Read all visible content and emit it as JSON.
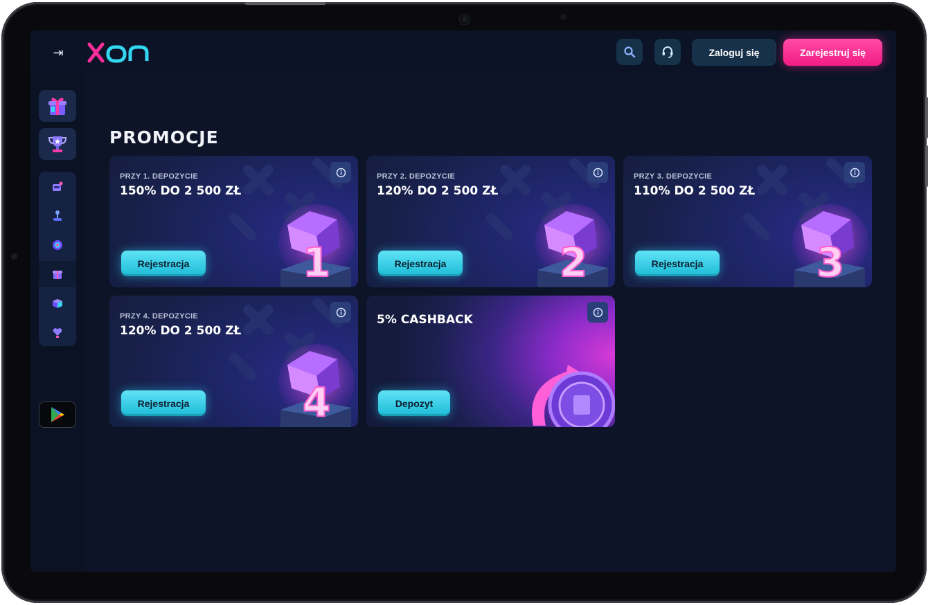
{
  "header": {
    "brand": "XON",
    "login_label": "Zaloguj się",
    "register_label": "Zarejestruj się"
  },
  "page": {
    "title": "PROMOCJE"
  },
  "promotions": [
    {
      "kicker": "PRZY 1. DEPOZYCIE",
      "headline": "150% DO 2 500 ZŁ",
      "cta": "Rejestracja",
      "digit": "1"
    },
    {
      "kicker": "PRZY 2. DEPOZYCIE",
      "headline": "120% DO 2 500 ZŁ",
      "cta": "Rejestracja",
      "digit": "2"
    },
    {
      "kicker": "PRZY 3. DEPOZYCIE",
      "headline": "110% DO 2 500 ZŁ",
      "cta": "Rejestracja",
      "digit": "3"
    },
    {
      "kicker": "PRZY 4. DEPOZYCIE",
      "headline": "120% DO 2 500 ZŁ",
      "cta": "Rejestracja",
      "digit": "4"
    },
    {
      "kicker": "",
      "headline": "5% CASHBACK",
      "cta": "Depozyt"
    }
  ],
  "colors": {
    "accent_pink": "#f21d84",
    "accent_cyan": "#1dbbd8",
    "background": "#0d1428"
  }
}
